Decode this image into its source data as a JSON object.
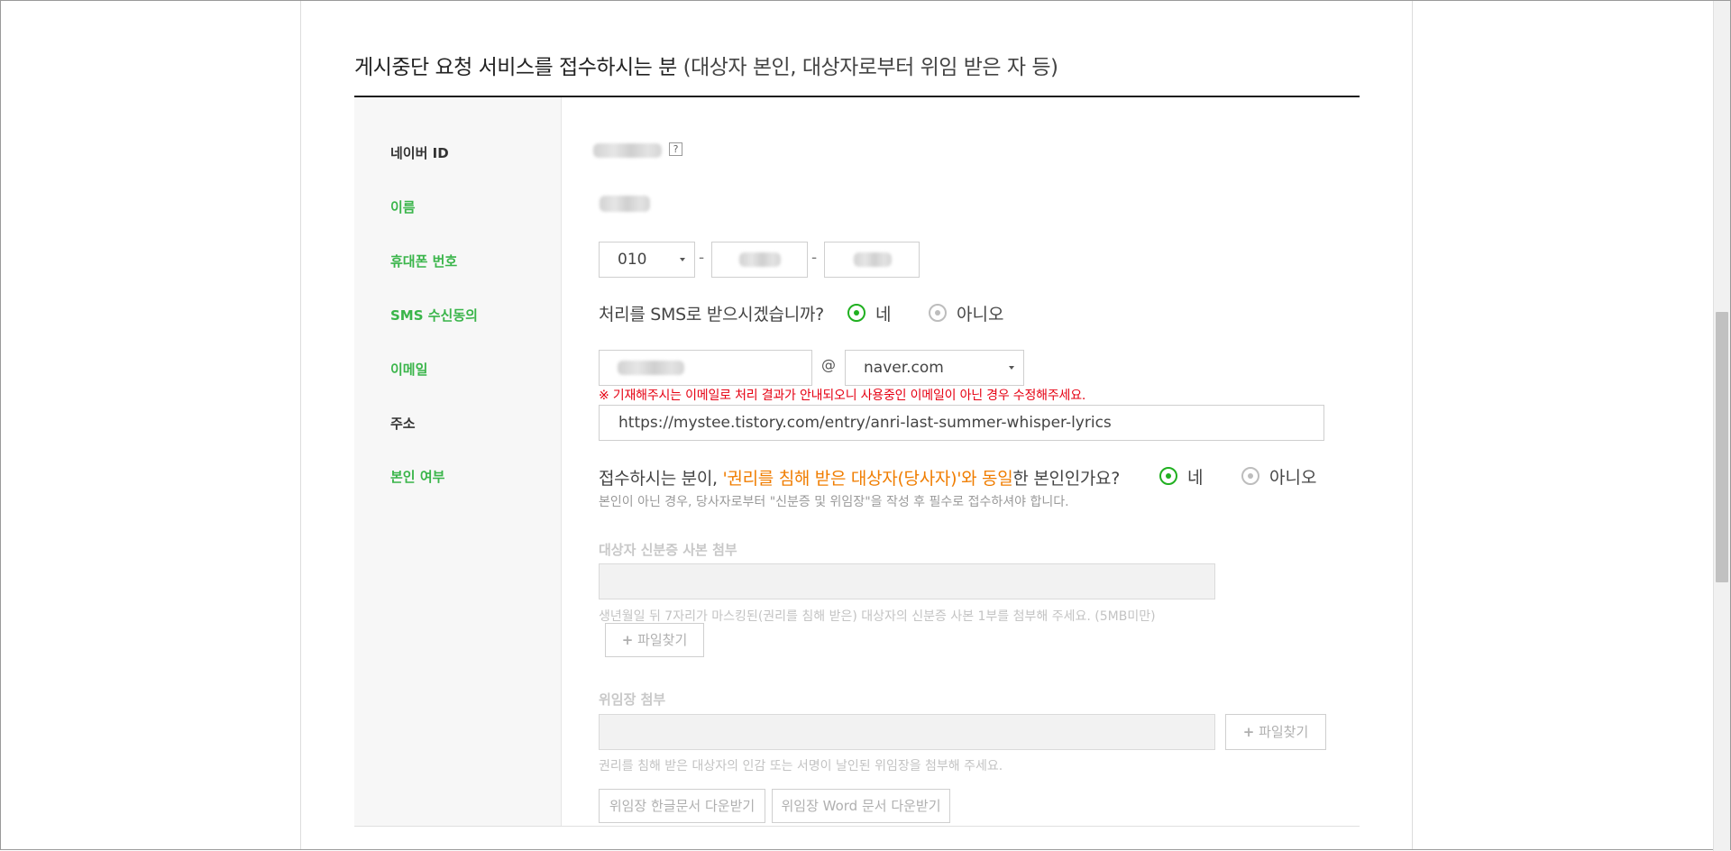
{
  "section": {
    "title_main": "게시중단 요청 서비스를 접수하시는 분",
    "title_paren": "(대상자 본인, 대상자로부터 위임 받은 자 등)"
  },
  "labels": {
    "naver_id": "네이버 ID",
    "name": "이름",
    "phone": "휴대폰 번호",
    "sms": "SMS 수신동의",
    "email": "이메일",
    "address": "주소",
    "identity": "본인 여부"
  },
  "phone": {
    "prefix": "010",
    "dash": "-"
  },
  "sms": {
    "question": "처리를 SMS로 받으시겠습니까?",
    "yes": "네",
    "no": "아니오"
  },
  "email": {
    "at": "@",
    "domain": "naver.com",
    "notice": "※ 기재해주시는 이메일로 처리 결과가 안내되오니 사용중인 이메일이 아닌 경우 수정해주세요."
  },
  "address": {
    "value": "https://mystee.tistory.com/entry/anri-last-summer-whisper-lyrics"
  },
  "identity": {
    "q_prefix": "접수하시는 분이,",
    "q_highlight": "'권리를 침해 받은 대상자(당사자)'와 동일",
    "q_suffix": "한 본인인가요?",
    "yes": "네",
    "no": "아니오",
    "help": "본인이 아닌 경우, 당사자로부터 \"신분증 및 위임장\"을 작성 후 필수로 접수하셔야 합니다."
  },
  "id_copy": {
    "label": "대상자 신분증 사본 첨부",
    "help": "생년월일 뒤 7자리가 마스킹된(권리를 침해 받은) 대상자의 신분증 사본 1부를 첨부해 주세요. (5MB미만)",
    "button": "파일찾기"
  },
  "proxy": {
    "label": "위임장 첨부",
    "button": "파일찾기",
    "help": "권리를 침해 받은 대상자의 인감 또는 서명이 날인된 위임장을 첨부해 주세요.",
    "download_hwp": "위임장 한글문서 다운받기",
    "download_word": "위임장 Word 문서 다운받기"
  },
  "icons": {
    "help": "?",
    "plus": "+"
  },
  "colors": {
    "accent_green": "#3ab54a",
    "radio_green": "#20b020",
    "warning_red": "#e60012",
    "highlight_orange": "#f07d00"
  }
}
